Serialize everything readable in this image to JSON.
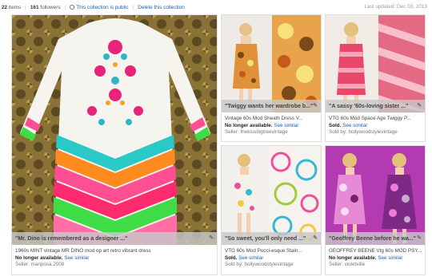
{
  "topbar": {
    "items_count": "22",
    "items_label": "items",
    "followers_count": "161",
    "followers_label": "followers",
    "public_link": "This collection is public",
    "delete_link": "Delete this collection",
    "last_updated": "Last updated: Dec 03, 2013"
  },
  "cards": [
    {
      "quote": "\"Mr. Dino is remembered as a designer ...\"",
      "title": "1960s MINT vintage MR DINO mod op art retro vibrant dress",
      "status": "No longer available.",
      "see_similar": "See similar",
      "seller": "Seller: mariposa.2008"
    },
    {
      "quote": "\"Twiggy wants her wardrobe b...\"",
      "title": "Vintage 60s Mod Sheath Dress V...",
      "status": "No longer available.",
      "see_similar": "See similar",
      "seller": "Seller: thekissingtreevintage"
    },
    {
      "quote": "\"A sassy '60s-loving sister ...\"",
      "title": "VTG 60s Mod Space Age Twiggy P...",
      "status": "Sold.",
      "see_similar": "See similar",
      "seller": "Sold by: hollywoodstylevintage"
    },
    {
      "quote": "\"So sweet, you'll only need ...\"",
      "title": "VTG 60s Mod Pucci-esque Stain...",
      "status": "Sold.",
      "see_similar": "See similar",
      "seller": "Sold by: hollywoodstylevintage"
    },
    {
      "quote": "\"Geoffrey Beene before he wa...\"",
      "title": "GEOFFREY BEENE Vtg 60s MOD PSY...",
      "status": "No longer available.",
      "see_similar": "See similar",
      "seller": "Seller: violetville"
    }
  ]
}
